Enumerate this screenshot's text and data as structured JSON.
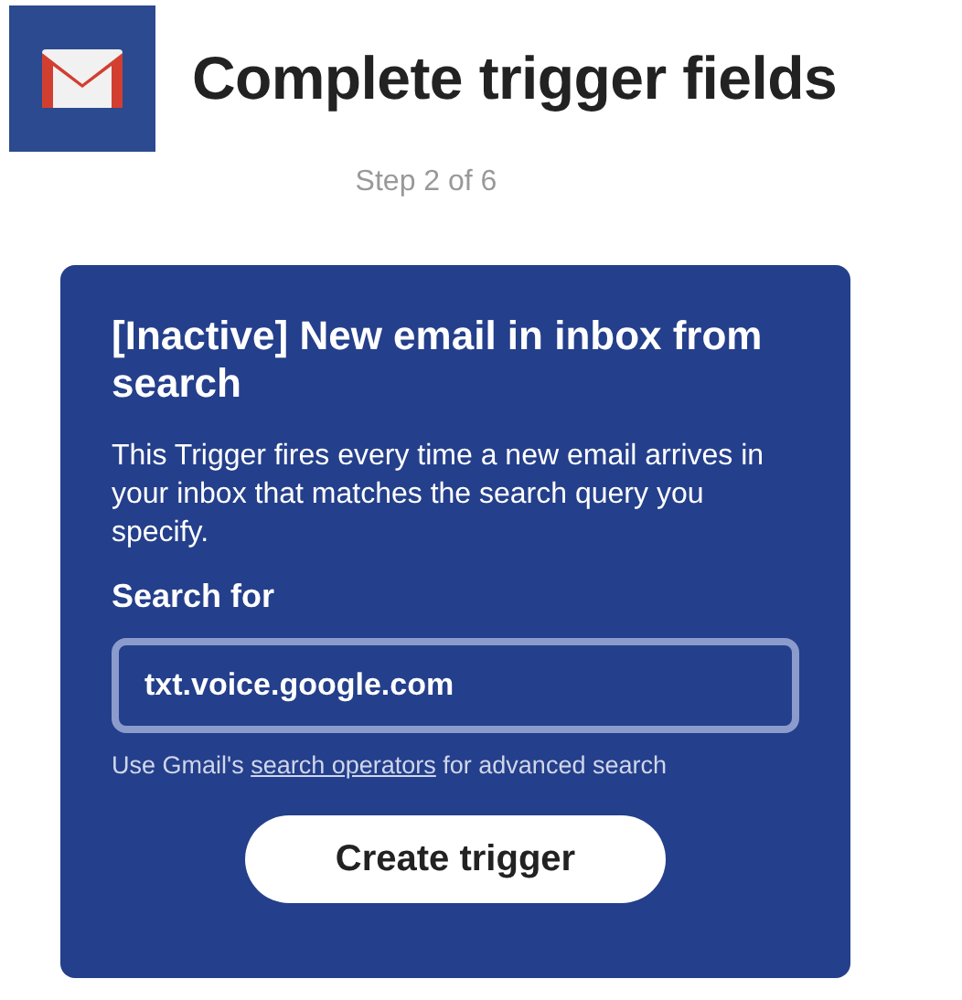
{
  "header": {
    "title": "Complete trigger fields",
    "step": "Step 2 of 6"
  },
  "card": {
    "title": "[Inactive] New email in inbox from search",
    "description": "This Trigger fires every time a new email arrives in your inbox that matches the search query you specify.",
    "field_label": "Search for",
    "field_value": "txt.voice.google.com",
    "help_before": "Use Gmail's ",
    "help_link": "search operators",
    "help_after": " for advanced search",
    "button": "Create trigger"
  }
}
